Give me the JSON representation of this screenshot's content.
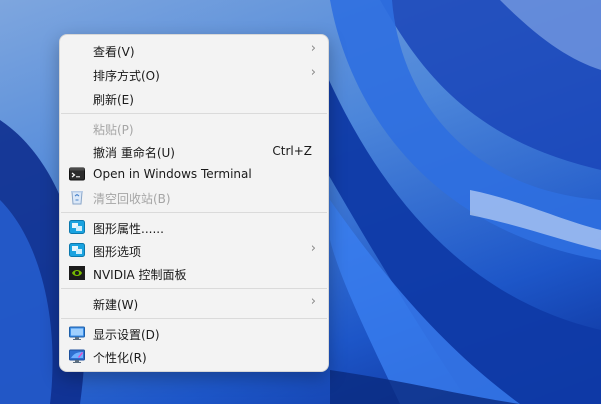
{
  "menu": {
    "view": {
      "label": "查看(V)",
      "icon": "none"
    },
    "sort": {
      "label": "排序方式(O)"
    },
    "refresh": {
      "label": "刷新(E)"
    },
    "paste": {
      "label": "粘贴(P)"
    },
    "undo": {
      "label": "撤消 重命名(U)",
      "shortcut": "Ctrl+Z"
    },
    "terminal": {
      "label": "Open in Windows Terminal",
      "icon": "terminal-icon"
    },
    "empty_bin": {
      "label": "清空回收站(B)",
      "icon": "recycle-bin-icon"
    },
    "gfx_props": {
      "label": "图形属性......",
      "icon": "intel-graphics-icon"
    },
    "gfx_options": {
      "label": "图形选项",
      "icon": "intel-graphics-icon"
    },
    "nvidia": {
      "label": "NVIDIA 控制面板",
      "icon": "nvidia-icon"
    },
    "new": {
      "label": "新建(W)"
    },
    "display": {
      "label": "显示设置(D)",
      "icon": "monitor-icon"
    },
    "personalize": {
      "label": "个性化(R)",
      "icon": "personalize-icon"
    },
    "submenu_indicator": "›"
  },
  "colors": {
    "menu_bg": "#f3f3f3",
    "disabled_text": "#a5a5a5",
    "desktop_accent": "#1d56c8"
  }
}
